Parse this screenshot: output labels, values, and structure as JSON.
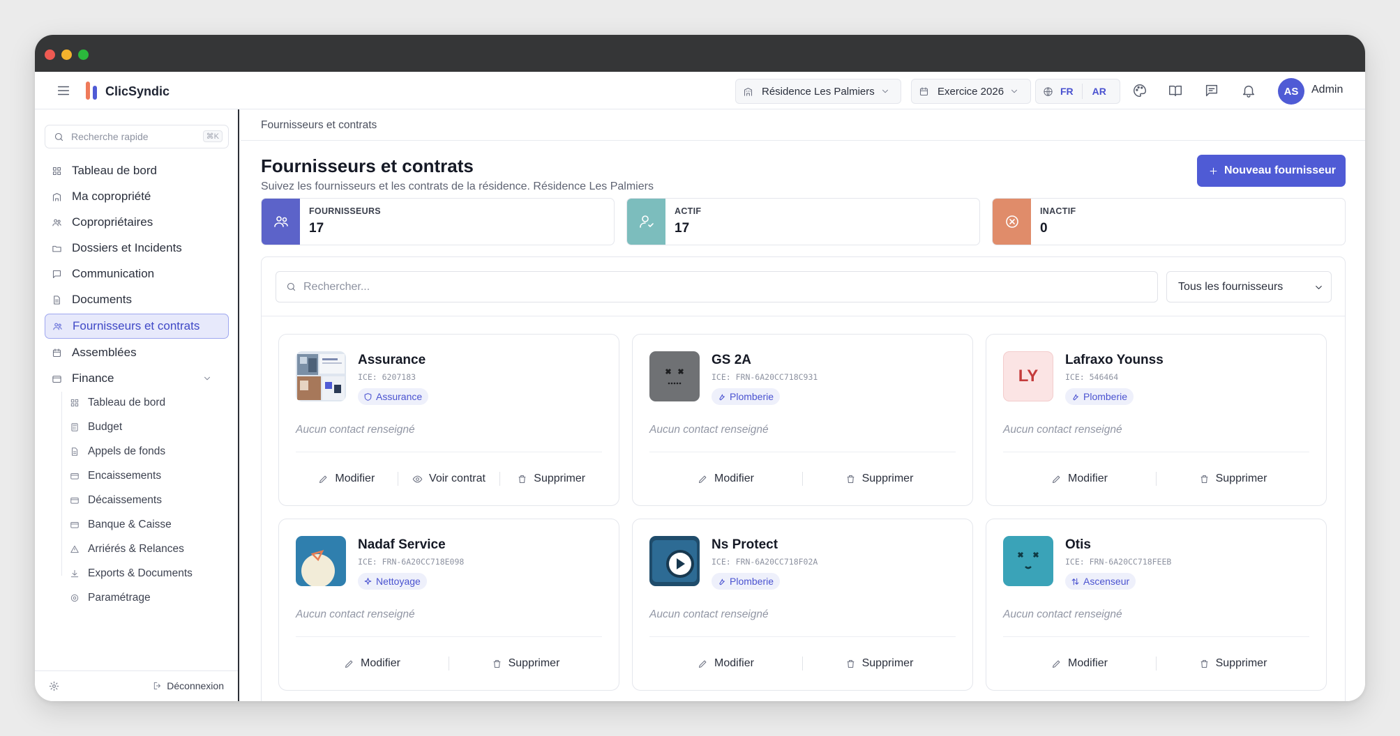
{
  "app": {
    "name": "ClicSyndic"
  },
  "topbar": {
    "residence": "Résidence Les Palmiers",
    "exercice": "Exercice 2026",
    "lang_fr": "FR",
    "lang_ar": "AR",
    "user_initials": "AS",
    "user_name": "Admin"
  },
  "sidebar": {
    "search_placeholder": "Recherche rapide",
    "search_shortcut": "⌘K",
    "items": [
      {
        "label": "Tableau de bord",
        "icon": "grid-icon"
      },
      {
        "label": "Ma copropriété",
        "icon": "building-icon"
      },
      {
        "label": "Copropriétaires",
        "icon": "users-icon"
      },
      {
        "label": "Dossiers et Incidents",
        "icon": "folder-icon"
      },
      {
        "label": "Communication",
        "icon": "message-icon"
      },
      {
        "label": "Documents",
        "icon": "document-icon"
      },
      {
        "label": "Fournisseurs et contrats",
        "icon": "users-icon",
        "active": true
      },
      {
        "label": "Assemblées",
        "icon": "calendar-icon"
      },
      {
        "label": "Finance",
        "icon": "wallet-icon"
      }
    ],
    "finance_sub": [
      {
        "label": "Tableau de bord"
      },
      {
        "label": "Budget"
      },
      {
        "label": "Appels de fonds"
      },
      {
        "label": "Encaissements"
      },
      {
        "label": "Décaissements"
      },
      {
        "label": "Banque & Caisse"
      },
      {
        "label": "Arriérés & Relances"
      },
      {
        "label": "Exports & Documents"
      },
      {
        "label": "Paramétrage"
      }
    ],
    "logout": "Déconnexion"
  },
  "page": {
    "breadcrumb": "Fournisseurs et contrats",
    "title": "Fournisseurs et contrats",
    "subtitle": "Suivez les fournisseurs et les contrats de la résidence. Résidence Les Palmiers",
    "new_button": "Nouveau fournisseur"
  },
  "stats": [
    {
      "label": "FOURNISSEURS",
      "value": "17",
      "color": "#5c63c9"
    },
    {
      "label": "ACTIF",
      "value": "17",
      "color": "#7cbdbd"
    },
    {
      "label": "INACTIF",
      "value": "0",
      "color": "#e08c6a"
    }
  ],
  "filters": {
    "search_placeholder": "Rechercher...",
    "select_value": "Tous les fournisseurs"
  },
  "suppliers": [
    {
      "name": "Assurance",
      "ice": "ICE: 6207183",
      "category": "Assurance",
      "contact": "Aucun contact renseigné",
      "actions": [
        "Modifier",
        "Voir contrat",
        "Supprimer"
      ]
    },
    {
      "name": "GS 2A",
      "ice": "ICE: FRN-6A20CC718C931",
      "category": "Plomberie",
      "contact": "Aucun contact renseigné",
      "actions": [
        "Modifier",
        "Supprimer"
      ]
    },
    {
      "name": "Lafraxo Younss",
      "ice": "ICE: 546464",
      "category": "Plomberie",
      "contact": "Aucun contact renseigné",
      "logo_text": "LY",
      "actions": [
        "Modifier",
        "Supprimer"
      ]
    },
    {
      "name": "Nadaf Service",
      "ice": "ICE: FRN-6A20CC718E098",
      "category": "Nettoyage",
      "contact": "Aucun contact renseigné",
      "actions": [
        "Modifier",
        "Supprimer"
      ]
    },
    {
      "name": "Ns Protect",
      "ice": "ICE: FRN-6A20CC718F02A",
      "category": "Plomberie",
      "contact": "Aucun contact renseigné",
      "actions": [
        "Modifier",
        "Supprimer"
      ]
    },
    {
      "name": "Otis",
      "ice": "ICE: FRN-6A20CC718FEEB",
      "category": "Ascenseur",
      "contact": "Aucun contact renseigné",
      "actions": [
        "Modifier",
        "Supprimer"
      ]
    }
  ]
}
